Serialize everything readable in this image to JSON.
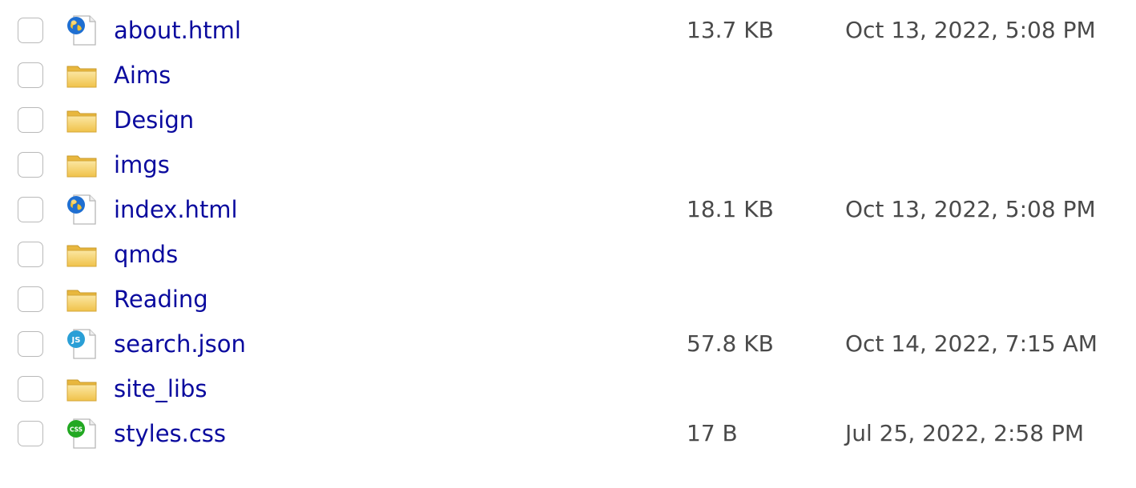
{
  "files": [
    {
      "name": "about.html",
      "type": "html",
      "size": "13.7 KB",
      "modified": "Oct 13, 2022, 5:08 PM"
    },
    {
      "name": "Aims",
      "type": "folder",
      "size": "",
      "modified": ""
    },
    {
      "name": "Design",
      "type": "folder",
      "size": "",
      "modified": ""
    },
    {
      "name": "imgs",
      "type": "folder",
      "size": "",
      "modified": ""
    },
    {
      "name": "index.html",
      "type": "html",
      "size": "18.1 KB",
      "modified": "Oct 13, 2022, 5:08 PM"
    },
    {
      "name": "qmds",
      "type": "folder",
      "size": "",
      "modified": ""
    },
    {
      "name": "Reading",
      "type": "folder",
      "size": "",
      "modified": ""
    },
    {
      "name": "search.json",
      "type": "json",
      "size": "57.8 KB",
      "modified": "Oct 14, 2022, 7:15 AM"
    },
    {
      "name": "site_libs",
      "type": "folder",
      "size": "",
      "modified": ""
    },
    {
      "name": "styles.css",
      "type": "css",
      "size": "17 B",
      "modified": "Jul 25, 2022, 2:58 PM"
    }
  ],
  "icons": {
    "html": {
      "icon": "globe-file-icon"
    },
    "folder": {
      "icon": "folder-icon"
    },
    "json": {
      "icon": "js-file-icon",
      "badge": "JS",
      "color": "#2a9fd6"
    },
    "css": {
      "icon": "css-file-icon",
      "badge": "CSS",
      "color": "#22a822"
    }
  },
  "colors": {
    "link": "#0a0a9e",
    "meta_text": "#4a4a4a",
    "checkbox_border": "#b9b9b9",
    "folder": "#f3c84a"
  }
}
